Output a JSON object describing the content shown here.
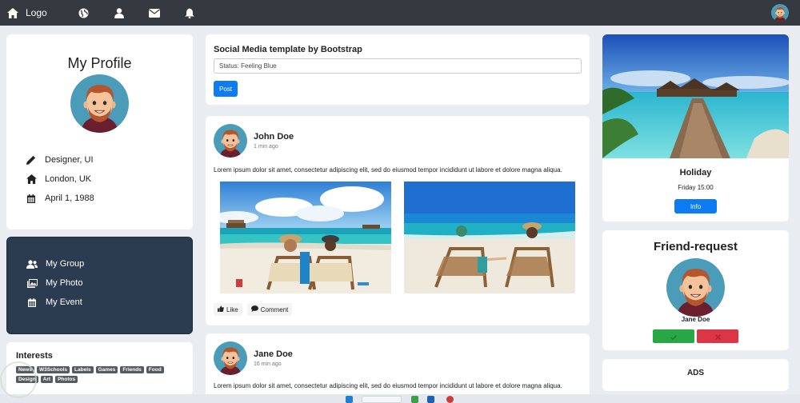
{
  "navbar": {
    "logo_label": "Logo",
    "icons": [
      "home-icon",
      "globe-icon",
      "user-icon",
      "envelope-icon",
      "bell-icon"
    ],
    "bg_color": "#343a40"
  },
  "profile": {
    "title": "My Profile",
    "job": "Designer, UI",
    "location": "London, UK",
    "birthday": "April 1, 1988"
  },
  "menu": {
    "items": [
      {
        "label": "My Group",
        "icon": "users-icon"
      },
      {
        "label": "My Photo",
        "icon": "photo-icon"
      },
      {
        "label": "My Event",
        "icon": "calendar-icon"
      }
    ],
    "bg_color": "#2b3c50"
  },
  "interests": {
    "title": "Interests",
    "tags": [
      "News",
      "W3Schools",
      "Labels",
      "Games",
      "Friends",
      "Food",
      "Design",
      "Art",
      "Photos"
    ]
  },
  "status": {
    "title": "Social Media template by Bootstrap",
    "input_value": "Status: Feeling Blue",
    "post_label": "Post"
  },
  "posts": [
    {
      "author": "John Doe",
      "time": "1 min ago",
      "text": "Lorem ipsum dolor sit amet, consectetur adipiscing elit, sed do eiusmod tempor incididunt ut labore et dolore magna aliqua.",
      "like_label": "Like",
      "comment_label": "Comment"
    },
    {
      "author": "Jane Doe",
      "time": "16 min ago",
      "text": "Lorem ipsum dolor sit amet, consectetur adipiscing elit, sed do eiusmod tempor incididunt ut labore et dolore magna aliqua."
    }
  ],
  "holiday": {
    "title": "Holiday",
    "time": "Friday 15:00",
    "info_label": "Info"
  },
  "friend_request": {
    "title": "Friend-request",
    "name": "Jane Doe",
    "accept_color": "#28a745",
    "decline_color": "#dc3545"
  },
  "ads": {
    "title": "ADS"
  },
  "colors": {
    "accent": "#0d7cf2",
    "page_bg": "#e9edf2"
  }
}
